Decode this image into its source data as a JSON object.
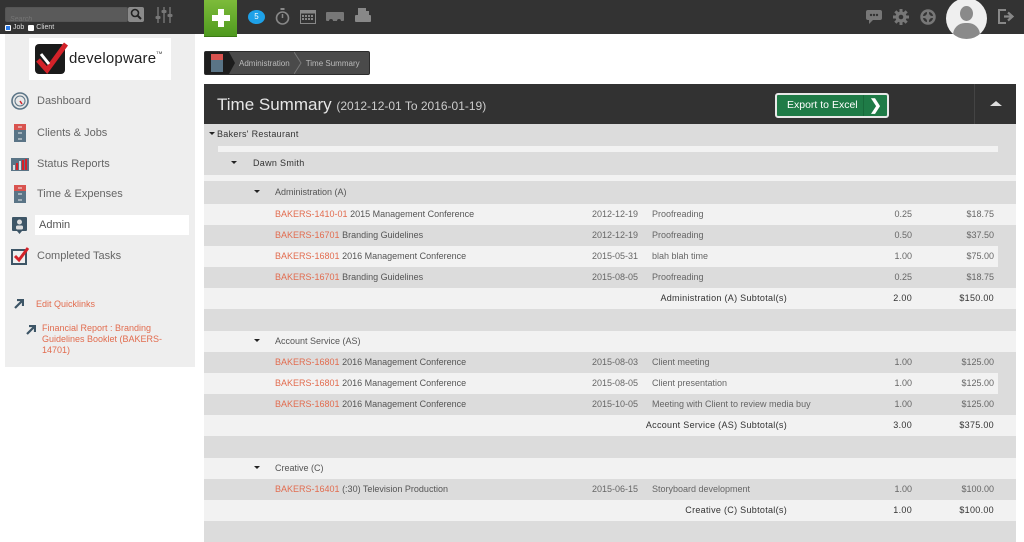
{
  "topbar": {
    "search_placeholder": "Search",
    "scope_options": [
      {
        "label": "Job",
        "checked": true
      },
      {
        "label": "Client",
        "checked": false
      }
    ],
    "notification_count": "5",
    "icons": [
      "search-icon",
      "filter-sliders-icon",
      "add-icon",
      "messages-icon",
      "stopwatch-icon",
      "calendar-icon",
      "truck-icon",
      "printer-icon",
      "chat-icon",
      "gear-icon",
      "help-lifebuoy-icon",
      "avatar",
      "logout-icon"
    ]
  },
  "sidebar": {
    "logo_text": "developware",
    "logo_tm": "TM",
    "items": [
      {
        "label": "Dashboard",
        "icon": "dashboard-gauge-icon",
        "active": false
      },
      {
        "label": "Clients & Jobs",
        "icon": "file-cabinet-icon",
        "active": false
      },
      {
        "label": "Status Reports",
        "icon": "bar-chart-icon",
        "active": false
      },
      {
        "label": "Time & Expenses",
        "icon": "file-cabinet-icon",
        "active": false
      },
      {
        "label": "Admin",
        "icon": "admin-badge-icon",
        "active": true
      },
      {
        "label": "Completed Tasks",
        "icon": "checkbox-icon",
        "active": false
      }
    ],
    "quicklinks": {
      "edit_label": "Edit Quicklinks",
      "links": [
        "Financial Report : Branding Guidelines Booklet (BAKERS-14701)"
      ]
    }
  },
  "breadcrumb": {
    "items": [
      "Administration",
      "Time Summary"
    ]
  },
  "panel": {
    "title": "Time Summary",
    "range": "(2012-12-01 To 2016-01-19)",
    "export_label": "Export to Excel",
    "export_chevron": "❯"
  },
  "report": {
    "client": "Bakers' Restaurant",
    "employee": "Dawn Smith",
    "groups": [
      {
        "name": "Administration (A)",
        "entries": [
          {
            "code": "BAKERS-1410-01",
            "job": "2015 Management Conference",
            "date": "2012-12-19",
            "desc": "Proofreading",
            "hours": "0.25",
            "amount": "$18.75"
          },
          {
            "code": "BAKERS-16701",
            "job": "Branding Guidelines",
            "date": "2012-12-19",
            "desc": "Proofreading",
            "hours": "0.50",
            "amount": "$37.50"
          },
          {
            "code": "BAKERS-16801",
            "job": "2016 Management Conference",
            "date": "2015-05-31",
            "desc": "blah blah time",
            "hours": "1.00",
            "amount": "$75.00"
          },
          {
            "code": "BAKERS-16701",
            "job": "Branding Guidelines",
            "date": "2015-08-05",
            "desc": "Proofreading",
            "hours": "0.25",
            "amount": "$18.75"
          }
        ],
        "subtotal_label": "Administration (A) Subtotal(s)",
        "subtotal_hours": "2.00",
        "subtotal_amount": "$150.00"
      },
      {
        "name": "Account Service (AS)",
        "entries": [
          {
            "code": "BAKERS-16801",
            "job": "2016 Management Conference",
            "date": "2015-08-03",
            "desc": "Client meeting",
            "hours": "1.00",
            "amount": "$125.00"
          },
          {
            "code": "BAKERS-16801",
            "job": "2016 Management Conference",
            "date": "2015-08-05",
            "desc": "Client presentation",
            "hours": "1.00",
            "amount": "$125.00"
          },
          {
            "code": "BAKERS-16801",
            "job": "2016 Management Conference",
            "date": "2015-10-05",
            "desc": "Meeting with Client to review media buy",
            "hours": "1.00",
            "amount": "$125.00"
          }
        ],
        "subtotal_label": "Account Service (AS) Subtotal(s)",
        "subtotal_hours": "3.00",
        "subtotal_amount": "$375.00"
      },
      {
        "name": "Creative (C)",
        "entries": [
          {
            "code": "BAKERS-16401",
            "job": "(:30) Television Production",
            "date": "2015-06-15",
            "desc": "Storyboard development",
            "hours": "1.00",
            "amount": "$100.00"
          }
        ],
        "subtotal_label": "Creative (C) Subtotal(s)",
        "subtotal_hours": "1.00",
        "subtotal_amount": "$100.00"
      }
    ]
  }
}
